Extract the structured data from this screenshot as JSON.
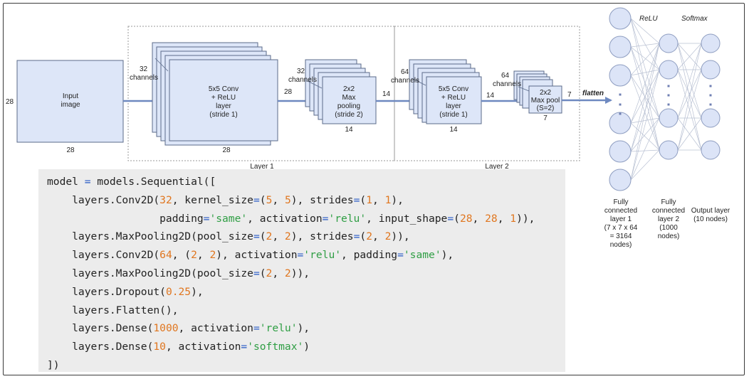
{
  "diagram": {
    "input": {
      "label_line1": "Input",
      "label_line2": "image",
      "dim_left": "28",
      "dim_bottom": "28"
    },
    "conv1": {
      "channels_num": "32",
      "channels_word": "channels",
      "label": [
        "5x5 Conv",
        "+ ReLU",
        "layer",
        "(stride 1)"
      ],
      "dim_right": "28",
      "dim_bottom": "28"
    },
    "pool1": {
      "channels_num": "32",
      "channels_word": "channels",
      "label": [
        "2x2",
        "Max",
        "pooling",
        "(stride 2)"
      ],
      "dim_right": "14",
      "dim_bottom": "14"
    },
    "conv2": {
      "channels_num": "64",
      "channels_word": "channels",
      "label": [
        "5x5 Conv",
        "+ ReLU",
        "layer",
        "(stride 1)"
      ],
      "dim_right": "14",
      "dim_bottom": "14"
    },
    "pool2": {
      "channels_num": "64",
      "channels_word": "channels",
      "label": [
        "2x2",
        "Max pool",
        "(S=2)"
      ],
      "dim_right": "7",
      "dim_bottom": "7"
    },
    "flatten_label": "flatten",
    "layer1_label": "Layer 1",
    "layer2_label": "Layer 2",
    "relu_label": "ReLU",
    "softmax_label": "Softmax",
    "fc1_caption": [
      "Fully",
      "connected",
      "layer 1",
      "(7 x 7 x 64",
      "= 3164",
      "nodes)"
    ],
    "fc2_caption": [
      "Fully",
      "connected",
      "layer 2",
      "(1000",
      "nodes)"
    ],
    "out_caption": [
      "Output layer",
      "(10 nodes)"
    ],
    "colors": {
      "box_fill": "#dde6f8",
      "box_stroke": "#5b6b8a",
      "arrow": "#6e89c0",
      "node_fill": "#dce4f7",
      "node_stroke": "#8e9dc0",
      "dots": "#6f7fb3",
      "edge": "#b9c1d3"
    }
  },
  "code": {
    "lines": [
      [
        {
          "t": "model "
        },
        {
          "t": "=",
          "c": "op"
        },
        {
          "t": " models.Sequential(["
        }
      ],
      [
        {
          "t": "    layers.Conv2D("
        },
        {
          "t": "32",
          "c": "num"
        },
        {
          "t": ", kernel_size"
        },
        {
          "t": "=",
          "c": "op"
        },
        {
          "t": "("
        },
        {
          "t": "5",
          "c": "num"
        },
        {
          "t": ", "
        },
        {
          "t": "5",
          "c": "num"
        },
        {
          "t": "), strides"
        },
        {
          "t": "=",
          "c": "op"
        },
        {
          "t": "("
        },
        {
          "t": "1",
          "c": "num"
        },
        {
          "t": ", "
        },
        {
          "t": "1",
          "c": "num"
        },
        {
          "t": "),"
        }
      ],
      [
        {
          "t": "                  padding"
        },
        {
          "t": "=",
          "c": "op"
        },
        {
          "t": "'same'",
          "c": "str"
        },
        {
          "t": ", activation"
        },
        {
          "t": "=",
          "c": "op"
        },
        {
          "t": "'relu'",
          "c": "str"
        },
        {
          "t": ", input_shape"
        },
        {
          "t": "=",
          "c": "op"
        },
        {
          "t": "("
        },
        {
          "t": "28",
          "c": "num"
        },
        {
          "t": ", "
        },
        {
          "t": "28",
          "c": "num"
        },
        {
          "t": ", "
        },
        {
          "t": "1",
          "c": "num"
        },
        {
          "t": ")),"
        }
      ],
      [
        {
          "t": "    layers.MaxPooling2D(pool_size"
        },
        {
          "t": "=",
          "c": "op"
        },
        {
          "t": "("
        },
        {
          "t": "2",
          "c": "num"
        },
        {
          "t": ", "
        },
        {
          "t": "2",
          "c": "num"
        },
        {
          "t": "), strides"
        },
        {
          "t": "=",
          "c": "op"
        },
        {
          "t": "("
        },
        {
          "t": "2",
          "c": "num"
        },
        {
          "t": ", "
        },
        {
          "t": "2",
          "c": "num"
        },
        {
          "t": ")),"
        }
      ],
      [
        {
          "t": "    layers.Conv2D("
        },
        {
          "t": "64",
          "c": "num"
        },
        {
          "t": ", ("
        },
        {
          "t": "2",
          "c": "num"
        },
        {
          "t": ", "
        },
        {
          "t": "2",
          "c": "num"
        },
        {
          "t": "), activation"
        },
        {
          "t": "=",
          "c": "op"
        },
        {
          "t": "'relu'",
          "c": "str"
        },
        {
          "t": ", padding"
        },
        {
          "t": "=",
          "c": "op"
        },
        {
          "t": "'same'",
          "c": "str"
        },
        {
          "t": "),"
        }
      ],
      [
        {
          "t": "    layers.MaxPooling2D(pool_size"
        },
        {
          "t": "=",
          "c": "op"
        },
        {
          "t": "("
        },
        {
          "t": "2",
          "c": "num"
        },
        {
          "t": ", "
        },
        {
          "t": "2",
          "c": "num"
        },
        {
          "t": ")),"
        }
      ],
      [
        {
          "t": "    layers.Dropout("
        },
        {
          "t": "0.25",
          "c": "num"
        },
        {
          "t": "),"
        }
      ],
      [
        {
          "t": "    layers.Flatten(),"
        }
      ],
      [
        {
          "t": "    layers.Dense("
        },
        {
          "t": "1000",
          "c": "num"
        },
        {
          "t": ", activation"
        },
        {
          "t": "=",
          "c": "op"
        },
        {
          "t": "'relu'",
          "c": "str"
        },
        {
          "t": "),"
        }
      ],
      [
        {
          "t": "    layers.Dense("
        },
        {
          "t": "10",
          "c": "num"
        },
        {
          "t": ", activation"
        },
        {
          "t": "=",
          "c": "op"
        },
        {
          "t": "'softmax'",
          "c": "str"
        },
        {
          "t": ")"
        }
      ],
      [
        {
          "t": "])"
        }
      ]
    ]
  }
}
